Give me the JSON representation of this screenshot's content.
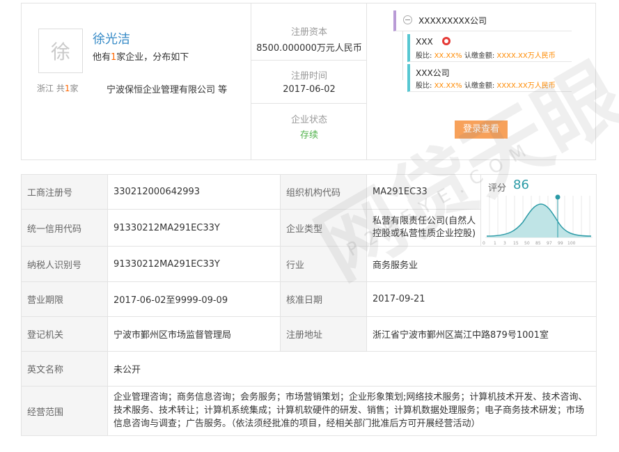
{
  "person": {
    "avatar_char": "徐",
    "name": "徐光洁",
    "sub_prefix": "他有",
    "sub_count": "1",
    "sub_suffix": "家企业，分布如下",
    "location": "浙江",
    "loc_prefix": "共",
    "loc_count": "1",
    "loc_suffix": "家",
    "company": "宁波保恒企业管理有限公司 等"
  },
  "info": {
    "capital_label": "注册资本",
    "capital_value": "8500.000000万元人民币",
    "date_label": "注册时间",
    "date_value": "2017-06-02",
    "status_label": "企业状态",
    "status_value": "存续"
  },
  "tree": {
    "root_name": "XXXXXXXXX公司",
    "nodes": [
      {
        "name": "XXX",
        "ratio_label": "股比:",
        "ratio_value": "XX.XX%",
        "amount_label": "认缴金额:",
        "amount_value": "XXXX.XX万人民币"
      },
      {
        "name": "XXX公司",
        "ratio_label": "股比:",
        "ratio_value": "XX.XX%",
        "amount_label": "认缴金额:",
        "amount_value": "XXXX.XX万人民币"
      }
    ],
    "login_button": "登录查看"
  },
  "details": {
    "reg_no_label": "工商注册号",
    "reg_no_value": "330212000642993",
    "org_code_label": "组织机构代码",
    "org_code_value": "MA291EC33",
    "credit_code_label": "统一信用代码",
    "credit_code_value": "91330212MA291EC33Y",
    "type_label": "企业类型",
    "type_value": "私营有限责任公司(自然人控股或私营性质企业控股)",
    "tax_id_label": "纳税人识别号",
    "tax_id_value": "91330212MA291EC33Y",
    "industry_label": "行业",
    "industry_value": "商务服务业",
    "term_label": "营业期限",
    "term_value": "2017-06-02至9999-09-09",
    "approval_label": "核准日期",
    "approval_value": "2017-09-21",
    "authority_label": "登记机关",
    "authority_value": "宁波市鄞州区市场监督管理局",
    "address_label": "注册地址",
    "address_value": "浙江省宁波市鄞州区嵩江中路879号1001室",
    "english_label": "英文名称",
    "english_value": "未公开",
    "scope_label": "经营范围",
    "scope_value": "企业管理咨询；商务信息咨询；会务服务；市场营销策划；企业形象策划;网络技术服务；计算机技术开发、技术咨询、技术服务、技术转让；计算机系统集成；计算机软硬件的研发、销售；计算机数据处理服务；电子商务技术研发；市场信息咨询与调查；广告服务。（依法须经批准的项目，经相关部门批准后方可开展经营活动）"
  },
  "score": {
    "label": "评分",
    "value": "86",
    "scale_ticks": [
      "0",
      "1",
      "3",
      "15",
      "50",
      "85",
      "97",
      "99",
      "100"
    ],
    "accent_color": "#2a9aa6"
  },
  "watermark": {
    "text": "网贷天眼",
    "sub": "P2PEYE.COM"
  }
}
